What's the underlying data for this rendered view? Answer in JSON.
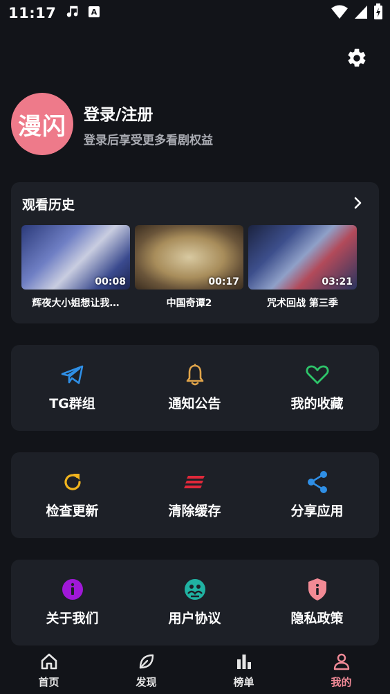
{
  "status_bar": {
    "time": "11:17",
    "left_icons": [
      "music-note-icon",
      "keyboard-a-icon"
    ],
    "right_icons": [
      "wifi-icon",
      "signal-icon",
      "battery-charging-icon"
    ]
  },
  "header": {
    "settings_icon": "gear-icon"
  },
  "profile": {
    "avatar_text": "漫闪",
    "avatar_color": "#ee7a8a",
    "login_title": "登录/注册",
    "login_subtitle": "登录后享受更多看剧权益"
  },
  "history": {
    "title": "观看历史",
    "items": [
      {
        "title": "辉夜大小姐想让我…",
        "time": "00:08"
      },
      {
        "title": "中国奇谭2",
        "time": "00:17"
      },
      {
        "title": "咒术回战 第三季",
        "time": "03:21"
      }
    ]
  },
  "grid1": [
    {
      "label": "TG群组",
      "icon": "telegram-icon",
      "color": "#2f8fe6"
    },
    {
      "label": "通知公告",
      "icon": "bell-icon",
      "color": "#e0a44a"
    },
    {
      "label": "我的收藏",
      "icon": "heart-icon",
      "color": "#2ec46a"
    }
  ],
  "grid2": [
    {
      "label": "检查更新",
      "icon": "refresh-icon",
      "color": "#f0b41e"
    },
    {
      "label": "清除缓存",
      "icon": "clear-cache-icon",
      "color": "#e0283a"
    },
    {
      "label": "分享应用",
      "icon": "share-icon",
      "color": "#2f8fe6"
    }
  ],
  "grid3": [
    {
      "label": "关于我们",
      "icon": "info-icon",
      "color": "#a018d8"
    },
    {
      "label": "用户协议",
      "icon": "agreement-icon",
      "color": "#20b2a2"
    },
    {
      "label": "隐私政策",
      "icon": "shield-icon",
      "color": "#f28a95"
    }
  ],
  "bottom_nav": [
    {
      "label": "首页",
      "icon": "home-icon",
      "active": false
    },
    {
      "label": "发现",
      "icon": "leaf-icon",
      "active": false
    },
    {
      "label": "榜单",
      "icon": "bar-chart-icon",
      "active": false
    },
    {
      "label": "我的",
      "icon": "user-icon",
      "active": true
    }
  ],
  "accent_color": "#f08a97",
  "background_color": "#121419",
  "card_color": "#1d2027"
}
